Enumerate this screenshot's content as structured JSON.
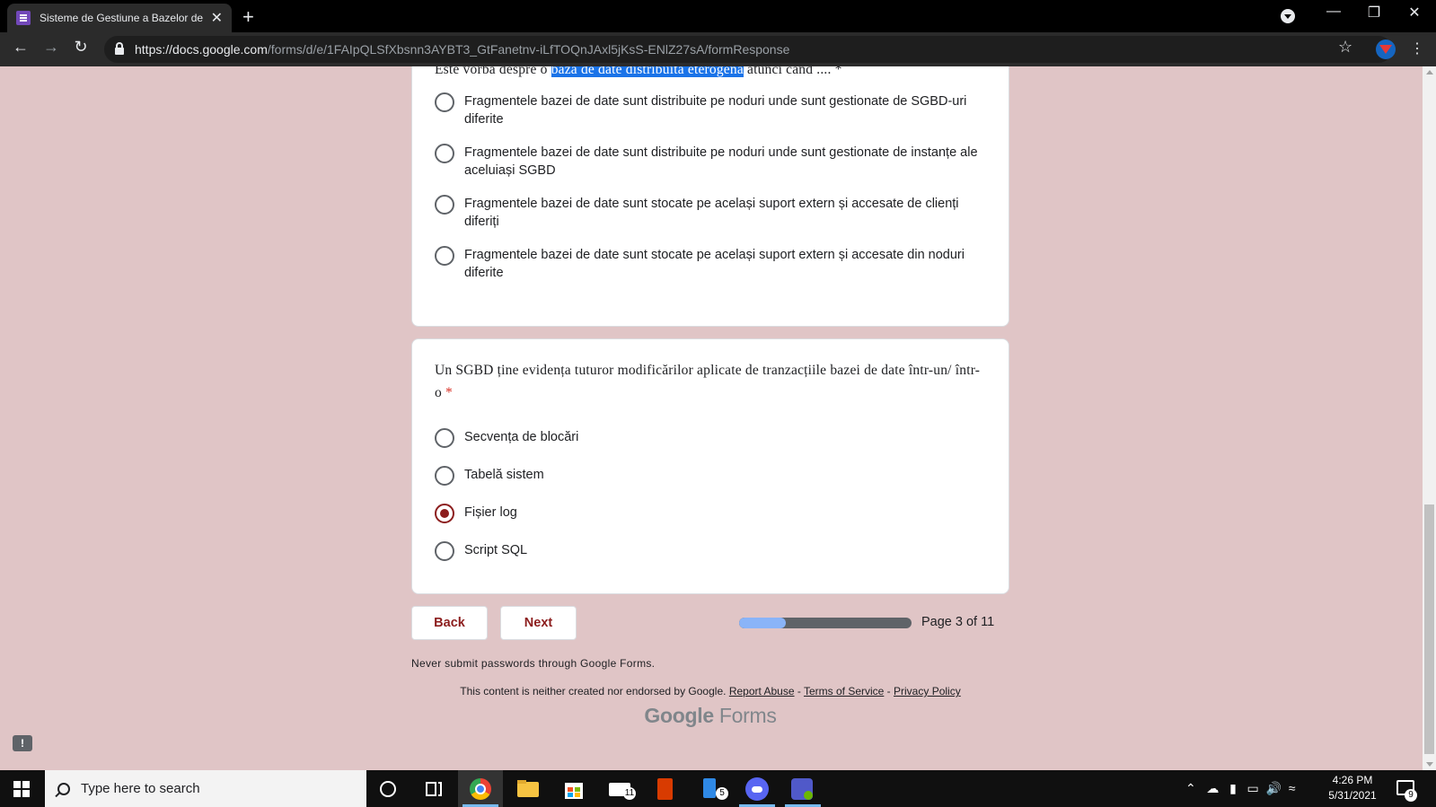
{
  "browser": {
    "tab_title": "Sisteme de Gestiune a Bazelor de",
    "tab_close": "✕",
    "new_tab": "+",
    "url_host": "https://docs.google.com",
    "url_path": "/forms/d/e/1FAIpQLSfXbsnn3AYBT3_GtFanetnv-iLfTOQnJAxl5jKsS-ENlZ27sA/formResponse"
  },
  "question1": {
    "title_prefix": "Este vorba despre o ",
    "title_highlight": "bază de date distribuită eterogenă",
    "title_suffix": " atunci când .... *",
    "options": [
      "Fragmentele bazei de date sunt distribuite pe noduri unde sunt gestionate de SGBD-uri diferite",
      "Fragmentele bazei de date sunt distribuite pe noduri unde sunt gestionate de instanțe ale aceluiași SGBD",
      "Fragmentele bazei de date sunt stocate pe același suport extern și accesate de clienți diferiți",
      "Fragmentele bazei de date sunt stocate pe același suport extern și accesate din noduri diferite"
    ]
  },
  "question2": {
    "title": "Un SGBD ține evidența tuturor modificărilor aplicate de tranzacțiile bazei de date într-un/ într-o",
    "required_marker": "*",
    "options": [
      "Secvența de blocări",
      "Tabelă sistem",
      "Fișier log",
      "Script SQL"
    ],
    "selected_index": 2
  },
  "navigation": {
    "back_label": "Back",
    "next_label": "Next",
    "progress_fraction": 0.27,
    "page_label": "Page 3 of 11"
  },
  "footer": {
    "password_warning": "Never submit passwords through Google Forms.",
    "disclaimer": "This content is neither created nor endorsed by Google.",
    "report_abuse": "Report Abuse",
    "terms": "Terms of Service",
    "privacy": "Privacy Policy",
    "separator": " - ",
    "brand_google": "Google",
    "brand_forms": " Forms"
  },
  "taskbar": {
    "search_placeholder": "Type here to search",
    "mail_badge": "11",
    "files_badge": "5",
    "time": "4:26 PM",
    "date": "5/31/2021",
    "notification_count": "9"
  },
  "colors": {
    "page_background": "#e0c5c6",
    "accent": "#8c1d1d",
    "highlight": "#1a73e8",
    "progress_fill": "#8ab4f8"
  }
}
